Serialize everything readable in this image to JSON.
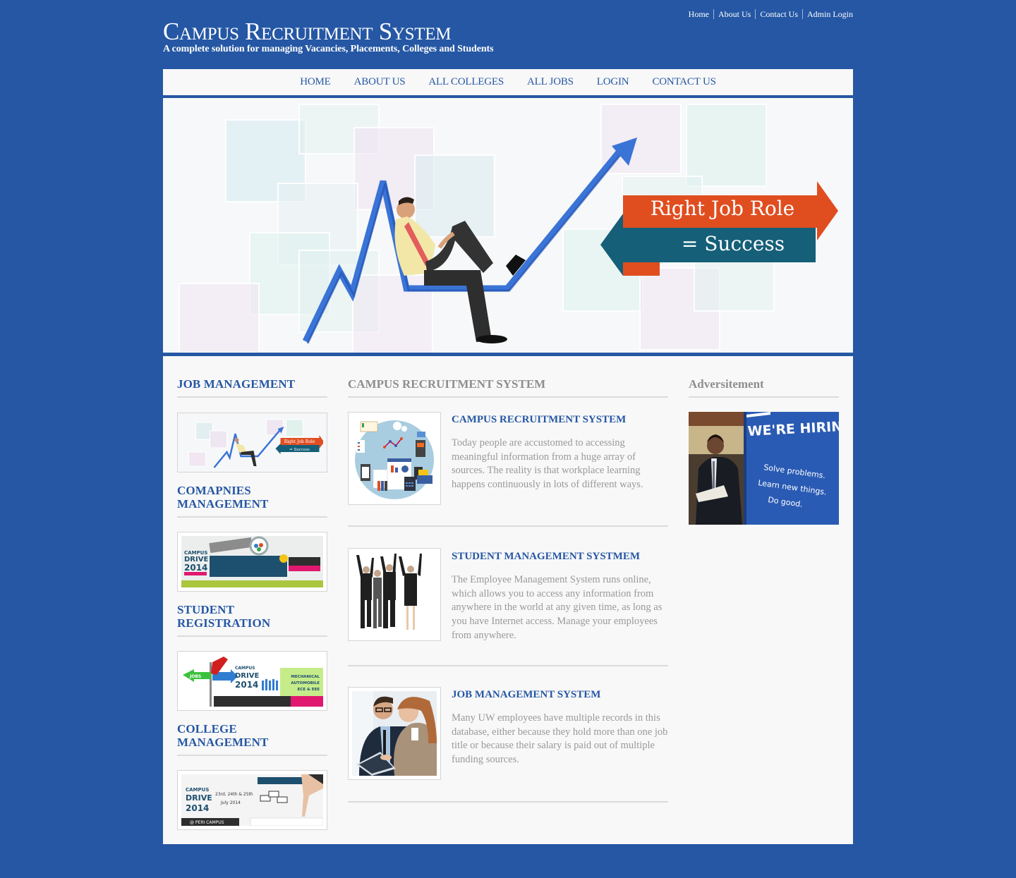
{
  "top_links": [
    "Home",
    "About Us",
    "Contact Us",
    "Admin Login"
  ],
  "brand": {
    "title": "Campus Recruitment System",
    "tagline": "A complete solution for managing Vacancies, Placements, Colleges and Students"
  },
  "main_nav": [
    "HOME",
    "ABOUT US",
    "ALL COLLEGES",
    "ALL JOBS",
    "LOGIN",
    "CONTACT US"
  ],
  "hero": {
    "line1": "Right Job Role",
    "line2": "= Success",
    "colors": {
      "orange": "#e04e20",
      "teal": "#155f78",
      "arrow": "#3a74d6"
    }
  },
  "sidebar": {
    "sections": [
      {
        "heading": "JOB MANAGEMENT",
        "thumb": "right-job-role-banner",
        "thumb_text_1": "Right Job Role",
        "thumb_text_2": "= Success"
      },
      {
        "heading": "COMAPNIES MANAGEMENT",
        "thumb": "campus-drive-2014-banner",
        "thumb_text_1": "CAMPUS",
        "thumb_text_2": "DRIVE",
        "thumb_text_3": "2014"
      },
      {
        "heading": "STUDENT REGISTRATION",
        "thumb": "campus-drive-2014-jobs-banner",
        "thumb_text_1": "CAMPUS",
        "thumb_text_2": "DRIVE",
        "thumb_text_3": "2014",
        "thumb_text_4": "MECHANICAL",
        "thumb_text_5": "AUTOMOBILE",
        "thumb_text_6": "ECE & EEE",
        "thumb_text_7": "JOBS"
      },
      {
        "heading": "COLLEGE MANAGEMENT",
        "thumb": "campus-drive-2014-july-banner",
        "thumb_text_1": "CAMPUS",
        "thumb_text_2": "DRIVE",
        "thumb_text_3": "2014",
        "thumb_text_4": "23rd, 24th & 25th",
        "thumb_text_5": "July 2014",
        "thumb_text_6": "@ PERI CAMPUS"
      }
    ]
  },
  "main": {
    "heading": "CAMPUS RECRUITMENT SYSTEM",
    "articles": [
      {
        "title": "CAMPUS RECRUITMENT SYSTEM",
        "body": "Today people are accustomed to accessing meaningful information from a huge array of sources. The reality is that workplace learning happens continuously in lots of different ways.",
        "image": "analytics-illustration"
      },
      {
        "title": "STUDENT MANAGEMENT SYSTMEM",
        "body": "The Employee Management System runs online, which allows you to access any information from anywhere in the world at any given time, as long as you have Internet access. Manage your employees from anywhere.",
        "image": "jumping-business-people"
      },
      {
        "title": "JOB MANAGEMENT SYSTEM",
        "body": "Many UW employees have multiple records in this database, either because they hold more than one job title or because their salary is paid out of multiple funding sources.",
        "image": "colleagues-with-tablet"
      }
    ]
  },
  "advertisement": {
    "heading": "Adversitement",
    "hiring": "WE'RE HIRING",
    "lines": [
      "Solve problems.",
      "Learn new things.",
      "Do good."
    ]
  }
}
